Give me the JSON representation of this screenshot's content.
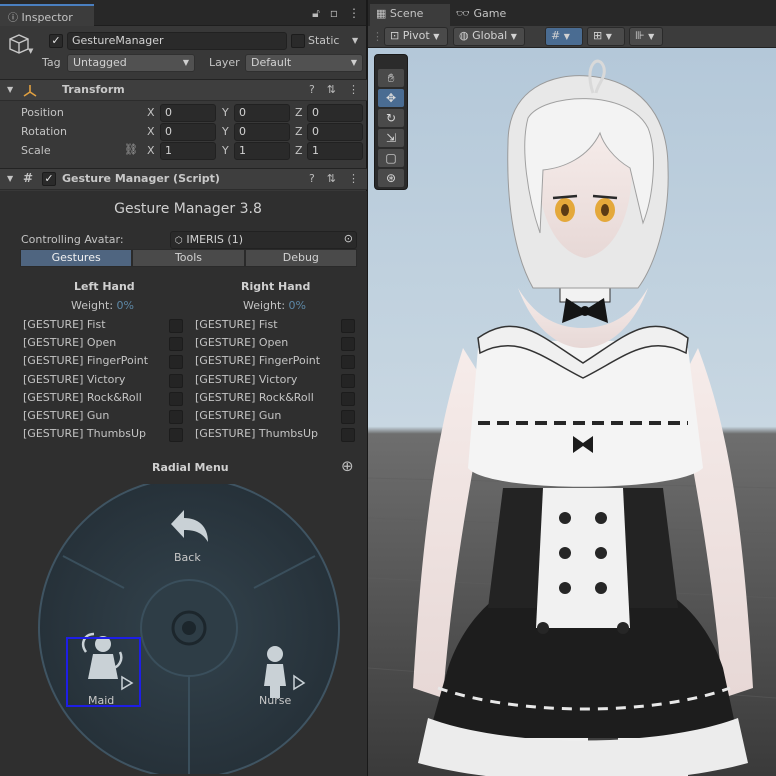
{
  "inspector": {
    "tab_label": "Inspector",
    "object_name": "GestureManager",
    "static_label": "Static",
    "tag_label": "Tag",
    "tag_value": "Untagged",
    "layer_label": "Layer",
    "layer_value": "Default"
  },
  "transform": {
    "title": "Transform",
    "position_label": "Position",
    "rotation_label": "Rotation",
    "scale_label": "Scale",
    "axis_x": "X",
    "axis_y": "Y",
    "axis_z": "Z",
    "position": [
      "0",
      "0",
      "0"
    ],
    "rotation": [
      "0",
      "0",
      "0"
    ],
    "scale": [
      "1",
      "1",
      "1"
    ]
  },
  "gesture_manager": {
    "header_title": "Gesture Manager (Script)",
    "heading": "Gesture Manager 3.8",
    "avatar_label": "Controlling Avatar:",
    "avatar_value": "IMERIS (1)",
    "tabs": [
      "Gestures",
      "Tools",
      "Debug"
    ],
    "left_hand": "Left Hand",
    "right_hand": "Right Hand",
    "weight_label": "Weight:",
    "weight_value": "0%",
    "gestures": [
      "[GESTURE] Fist",
      "[GESTURE] Open",
      "[GESTURE] FingerPoint",
      "[GESTURE] Victory",
      "[GESTURE] Rock&Roll",
      "[GESTURE] Gun",
      "[GESTURE] ThumbsUp"
    ],
    "radial_title": "Radial Menu",
    "radial_back": "Back",
    "radial_maid": "Maid",
    "radial_nurse": "Nurse"
  },
  "scene": {
    "tab_scene": "Scene",
    "tab_game": "Game",
    "pivot": "Pivot",
    "global": "Global"
  },
  "colors": {
    "selection_box": "#1e1ee6",
    "accent_blue": "#4a7fc0",
    "weight_text": "#5d88a6"
  }
}
